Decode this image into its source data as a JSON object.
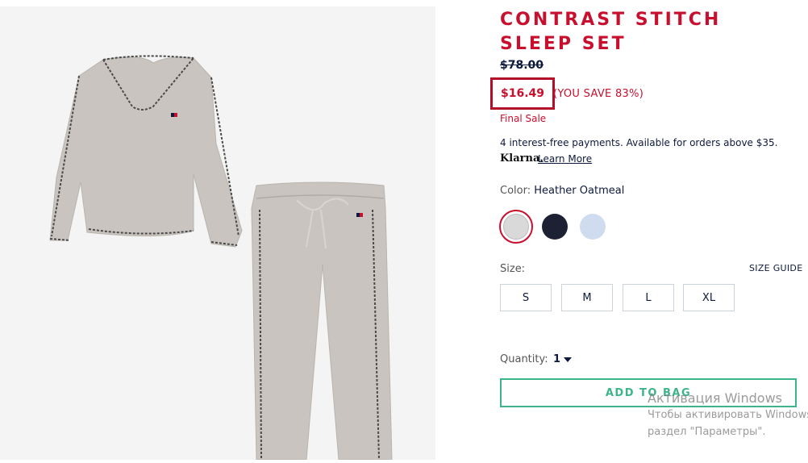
{
  "product": {
    "title": "CONTRAST STITCH SLEEP SET",
    "original_price": "$78.00",
    "sale_price": "$16.49",
    "savings": "(YOU SAVE 83%)",
    "final_sale": "Final Sale"
  },
  "klarna": {
    "text": "4 interest-free payments. Available for orders above $35.",
    "logo": "Klarna.",
    "learn_more": "Learn More"
  },
  "color": {
    "label": "Color:",
    "selected": "Heather Oatmeal",
    "swatches": [
      {
        "name": "Heather Oatmeal",
        "color": "#d9d9d9",
        "selected": true
      },
      {
        "name": "Navy",
        "color": "#1c2233",
        "selected": false
      },
      {
        "name": "Light Blue",
        "color": "#cfdcf0",
        "selected": false
      }
    ]
  },
  "size": {
    "label": "Size:",
    "guide": "SIZE GUIDE",
    "options": [
      "S",
      "M",
      "L",
      "XL"
    ]
  },
  "quantity": {
    "label": "Quantity:",
    "value": "1"
  },
  "cart": {
    "add_label": "ADD TO BAG"
  },
  "watermark": {
    "line1": "Активация Windows",
    "line2": "Чтобы активировать Windows, перейдите в",
    "line3": "раздел \"Параметры\"."
  },
  "colors": {
    "brand_red": "#c8102e",
    "navy": "#0e1a3d",
    "green": "#3eb489",
    "garment": "#c9c4bf",
    "stitch": "#4a4a4a"
  }
}
